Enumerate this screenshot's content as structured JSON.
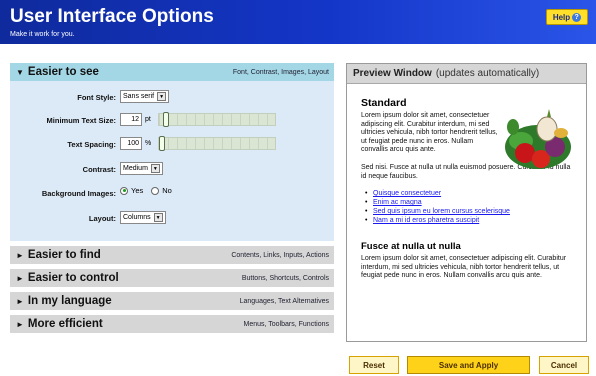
{
  "header": {
    "title": "User Interface Options",
    "subtitle": "Make it work for you.",
    "help_label": "Help",
    "help_icon": "?"
  },
  "sections": [
    {
      "title": "Easier to see",
      "links": "Font, Contrast, Images, Layout",
      "expanded": true
    },
    {
      "title": "Easier to find",
      "links": "Contents, Links, Inputs, Actions",
      "expanded": false
    },
    {
      "title": "Easier to control",
      "links": "Buttons, Shortcuts, Controls",
      "expanded": false
    },
    {
      "title": "In my language",
      "links": "Languages, Text Alternatives",
      "expanded": false
    },
    {
      "title": "More efficient",
      "links": "Menus, Toolbars, Functions",
      "expanded": false
    }
  ],
  "options": {
    "font_style": {
      "label": "Font Style:",
      "value": "Sans serif"
    },
    "min_text_size": {
      "label": "Minimum Text Size:",
      "value": "12",
      "unit": "pt",
      "slider_level": 0.04
    },
    "text_spacing": {
      "label": "Text Spacing:",
      "value": "100",
      "unit": "%",
      "slider_level": 0.0
    },
    "contrast": {
      "label": "Contrast:",
      "value": "Medium"
    },
    "background_images": {
      "label": "Background Images:",
      "yes": "Yes",
      "no": "No",
      "selected": "Yes"
    },
    "layout": {
      "label": "Layout:",
      "value": "Columns"
    }
  },
  "preview": {
    "title": "Preview Window",
    "subtitle": "(updates automatically)",
    "heading1": "Standard",
    "para1": "Lorem ipsum dolor sit amet, consectetuer adipiscing elit. Curabitur interdum, mi sed ultricies vehicula, nibh tortor hendrerit tellus, ut feugiat pede nunc in eros. Nullam convallis arcu quis ante.",
    "para2": "Sed nisi. Fusce at nulla ut nulla euismod posuere. Curabitur id nulla id neque faucibus.",
    "links": [
      "Quisque consectetuer",
      "Enim ac magna",
      "Sed quis ipsum eu lorem cursus scelerisque",
      "Nam a mi id eros pharetra suscipit"
    ],
    "heading2": "Fusce at nulla ut nulla",
    "para3": "Lorem ipsum dolor sit amet, consectetuer adipiscing elit. Curabitur interdum, mi sed ultricies vehicula, nibh tortor hendrerit tellus, ut feugiat pede nunc in eros. Nullam convallis arcu quis ante."
  },
  "buttons": {
    "reset": "Reset",
    "save": "Save and Apply",
    "cancel": "Cancel"
  },
  "colors": {
    "header_blue": "#1436c8",
    "accent_yellow": "#ffd21a",
    "section_open": "#a4d7e6",
    "section_closed": "#d6d6d6"
  }
}
